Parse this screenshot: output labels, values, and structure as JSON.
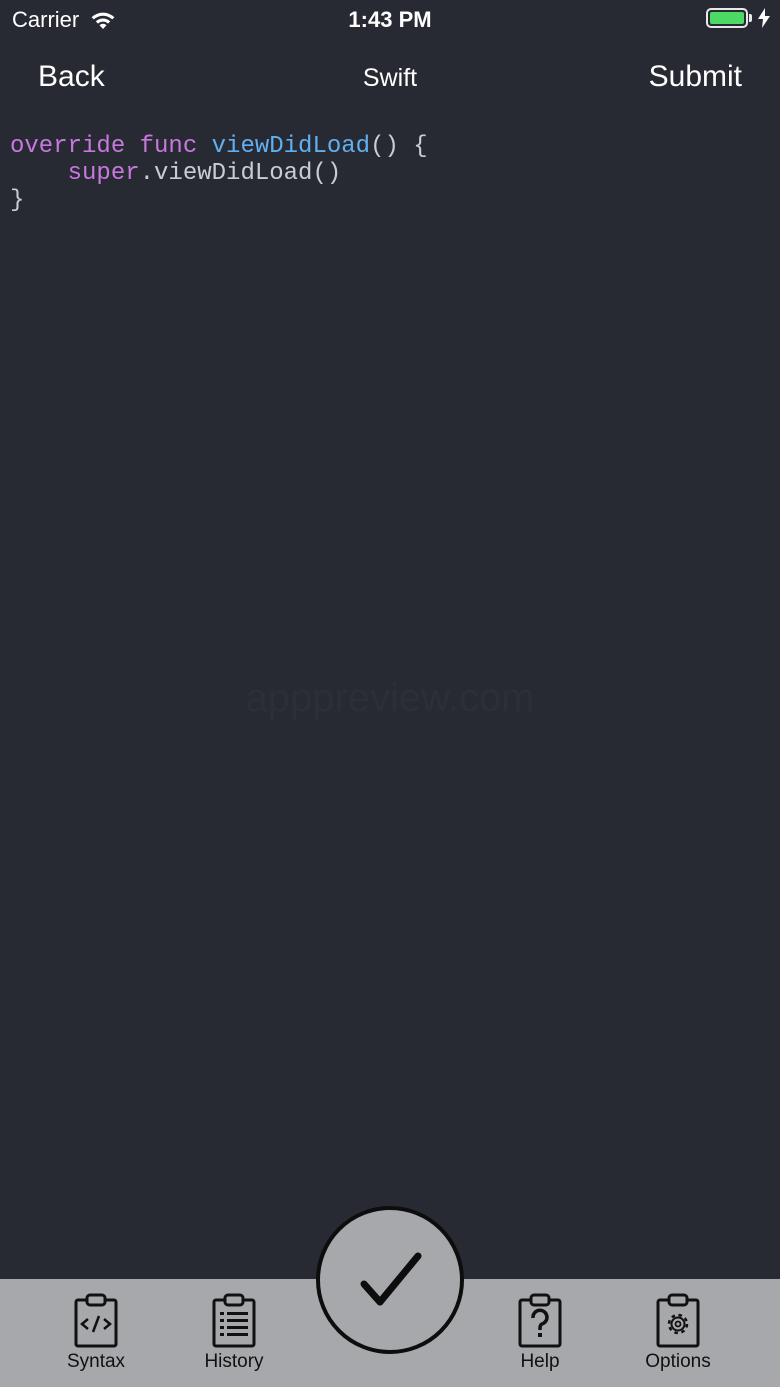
{
  "status_bar": {
    "carrier": "Carrier",
    "time": "1:43 PM",
    "battery_level": 1.0,
    "battery_color": "#4cd964",
    "charging": true
  },
  "nav": {
    "back_label": "Back",
    "title": "Swift",
    "submit_label": "Submit"
  },
  "editor": {
    "background": "#272a33",
    "lines": [
      [
        {
          "text": "override",
          "kind": "keyword"
        },
        {
          "text": " ",
          "kind": "plain"
        },
        {
          "text": "func",
          "kind": "keyword"
        },
        {
          "text": " ",
          "kind": "plain"
        },
        {
          "text": "viewDidLoad",
          "kind": "function"
        },
        {
          "text": "() {",
          "kind": "plain"
        }
      ],
      [
        {
          "text": "    ",
          "kind": "plain"
        },
        {
          "text": "super",
          "kind": "keyword"
        },
        {
          "text": ".viewDidLoad()",
          "kind": "plain"
        }
      ],
      [
        {
          "text": "}",
          "kind": "plain"
        }
      ]
    ],
    "colors": {
      "keyword": "#c678dd",
      "function": "#61afef",
      "plain": "#c8ccd4"
    }
  },
  "watermark": "apppreview.com",
  "run_button": {
    "icon": "checkmark-icon"
  },
  "tab_bar": {
    "background": "#a7a8ab",
    "tabs": [
      {
        "label": "Syntax",
        "icon": "clipboard-code-icon"
      },
      {
        "label": "History",
        "icon": "clipboard-list-icon"
      },
      {
        "label": "Help",
        "icon": "clipboard-question-icon"
      },
      {
        "label": "Options",
        "icon": "clipboard-gear-icon"
      }
    ]
  }
}
